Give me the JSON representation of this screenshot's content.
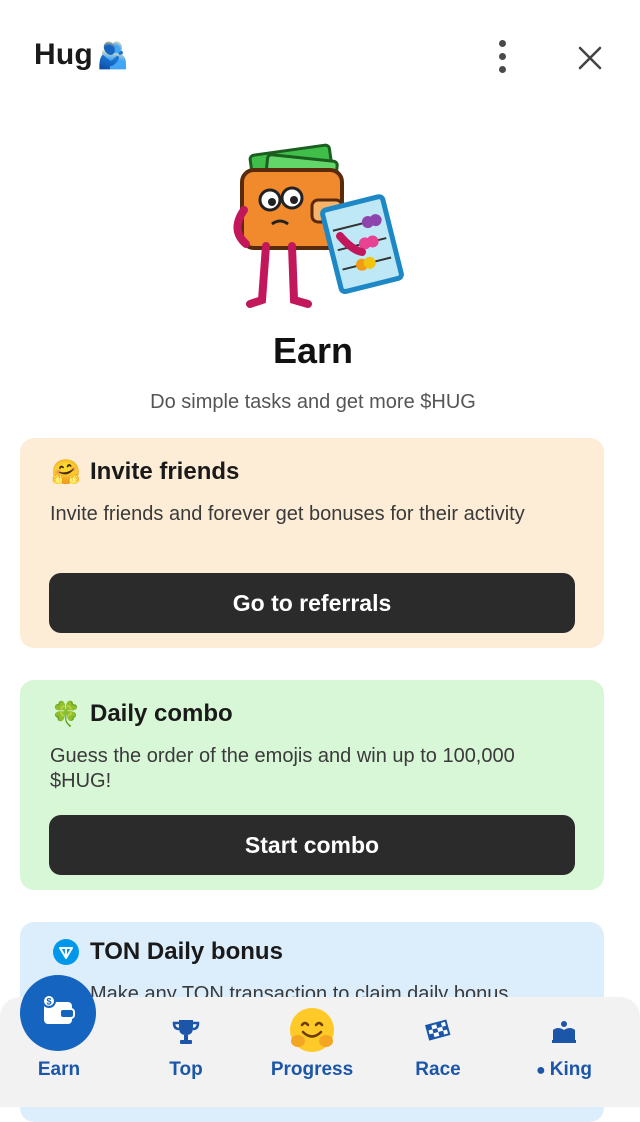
{
  "header": {
    "title": "Hug",
    "title_emoji": "🫂",
    "menu_icon": "vertical-dots-icon",
    "close_icon": "close-icon"
  },
  "hero": {
    "illustration": "wallet-abacus-character"
  },
  "page": {
    "title": "Earn",
    "subtitle": "Do simple tasks and get more $HUG"
  },
  "cards": [
    {
      "icon": "🤗",
      "title": "Invite friends",
      "description": "Invite friends and forever get bonuses for their activity",
      "button": "Go to referrals",
      "bg": "#fdecd6"
    },
    {
      "icon": "🍀",
      "title": "Daily combo",
      "description": "Guess the order of the emojis and win up to 100,000 $HUG!",
      "button": "Start combo",
      "bg": "#d8f7d7"
    },
    {
      "icon": "ton-icon",
      "title": "TON Daily bonus",
      "description": "Make any TON transaction to claim daily bonus",
      "bg": "#dcedfc"
    }
  ],
  "nav": {
    "items": [
      {
        "label": "Earn",
        "icon": "wallet-icon",
        "active": true
      },
      {
        "label": "Top",
        "icon": "trophy-icon"
      },
      {
        "label": "Progress",
        "icon": "hugging-face-icon"
      },
      {
        "label": "Race",
        "icon": "checkered-flag-icon"
      },
      {
        "label": "King",
        "icon": "crown-icon",
        "badge": "●"
      }
    ]
  },
  "colors": {
    "accent": "#1c56a8",
    "active_nav": "#1565c0",
    "button_dark": "#2b2b2b"
  }
}
